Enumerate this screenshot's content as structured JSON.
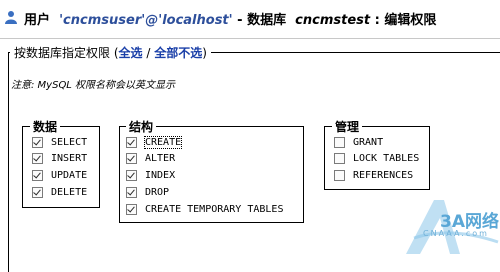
{
  "header": {
    "user_prefix": "用户",
    "user_name": "'cncmsuser'@'localhost'",
    "db_prefix": " - 数据库",
    "db_name": "cncmstest",
    "page_suffix": " : 编辑权限"
  },
  "privileges": {
    "legend": "按数据库指定权限",
    "open_paren": "(",
    "select_all": "全选",
    "separator": " / ",
    "deselect_all": "全部不选",
    "close_paren": ")",
    "note": "注意: MySQL 权限名称会以英文显示"
  },
  "groups": {
    "data": {
      "label": "数据",
      "items": [
        {
          "label": "SELECT",
          "checked": true
        },
        {
          "label": "INSERT",
          "checked": true
        },
        {
          "label": "UPDATE",
          "checked": true
        },
        {
          "label": "DELETE",
          "checked": true
        }
      ]
    },
    "structure": {
      "label": "结构",
      "items": [
        {
          "label": "CREATE",
          "checked": true
        },
        {
          "label": "ALTER",
          "checked": true
        },
        {
          "label": "INDEX",
          "checked": true
        },
        {
          "label": "DROP",
          "checked": true
        },
        {
          "label": "CREATE TEMPORARY TABLES",
          "checked": true
        }
      ]
    },
    "admin": {
      "label": "管理",
      "items": [
        {
          "label": "GRANT",
          "checked": false
        },
        {
          "label": "LOCK TABLES",
          "checked": false
        },
        {
          "label": "REFERENCES",
          "checked": false
        }
      ]
    }
  },
  "watermark": {
    "text_cn": "3A网络",
    "text_en": "CNAAA.com",
    "color": "#5aa7d6"
  }
}
